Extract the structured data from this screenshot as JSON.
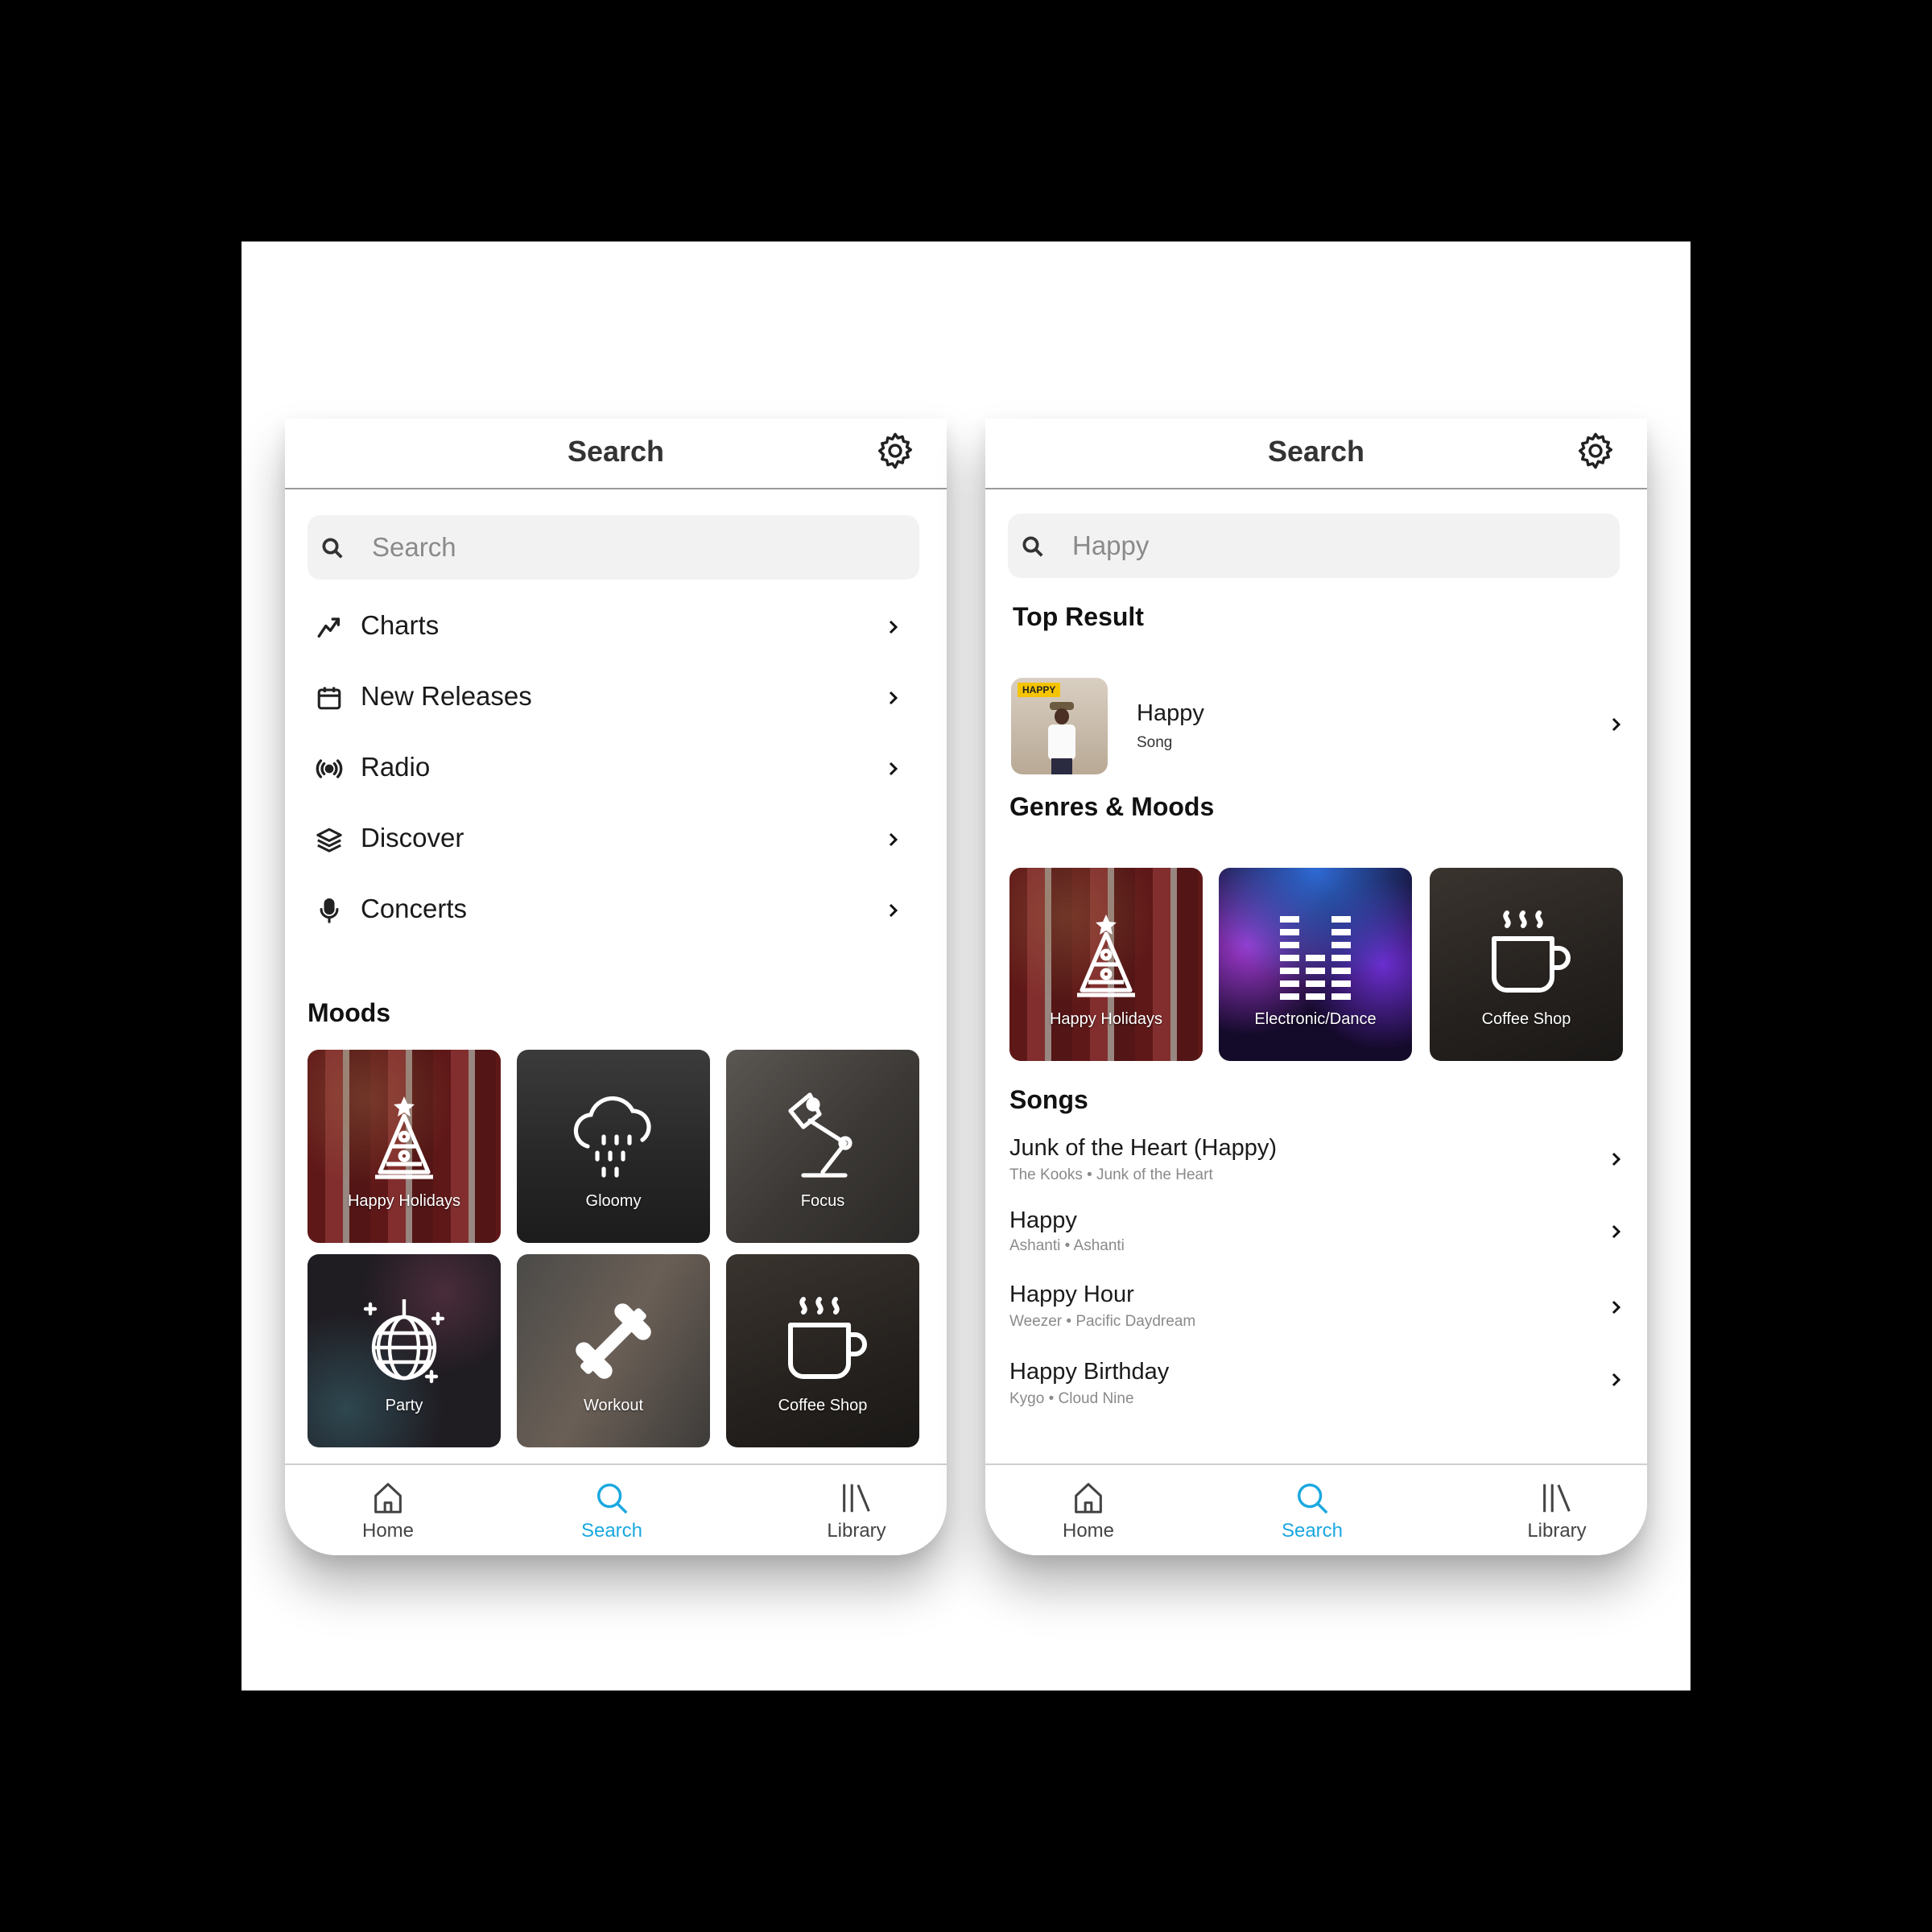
{
  "left_screen": {
    "header": {
      "title": "Search"
    },
    "search": {
      "placeholder": "Search"
    },
    "menu": [
      {
        "label": "Charts",
        "icon": "trending-up-icon"
      },
      {
        "label": "New Releases",
        "icon": "calendar-icon"
      },
      {
        "label": "Radio",
        "icon": "broadcast-icon"
      },
      {
        "label": "Discover",
        "icon": "layers-icon"
      },
      {
        "label": "Concerts",
        "icon": "microphone-icon"
      }
    ],
    "moods_title": "Moods",
    "moods": [
      {
        "label": "Happy Holidays",
        "icon": "christmas-tree-icon"
      },
      {
        "label": "Gloomy",
        "icon": "rain-cloud-icon"
      },
      {
        "label": "Focus",
        "icon": "desk-lamp-icon"
      },
      {
        "label": "Party",
        "icon": "disco-ball-icon"
      },
      {
        "label": "Workout",
        "icon": "dumbbell-icon"
      },
      {
        "label": "Coffee Shop",
        "icon": "coffee-cup-icon"
      }
    ]
  },
  "right_screen": {
    "header": {
      "title": "Search"
    },
    "search": {
      "value": "Happy"
    },
    "top_result_title": "Top Result",
    "top_result": {
      "title": "Happy",
      "type": "Song",
      "art_label": "HAPPY"
    },
    "genres_title": "Genres & Moods",
    "genres": [
      {
        "label": "Happy Holidays",
        "icon": "christmas-tree-icon"
      },
      {
        "label": "Electronic/Dance",
        "icon": "equalizer-icon"
      },
      {
        "label": "Coffee Shop",
        "icon": "coffee-cup-icon"
      }
    ],
    "songs_title": "Songs",
    "songs": [
      {
        "title": "Junk of the Heart (Happy)",
        "subtitle": "The Kooks • Junk of the Heart"
      },
      {
        "title": "Happy",
        "subtitle": "Ashanti • Ashanti"
      },
      {
        "title": "Happy Hour",
        "subtitle": "Weezer • Pacific Daydream"
      },
      {
        "title": "Happy Birthday",
        "subtitle": "Kygo • Cloud Nine"
      }
    ]
  },
  "tabbar": {
    "home": "Home",
    "search": "Search",
    "library": "Library",
    "active": "search",
    "active_color": "#1aa8e0"
  }
}
